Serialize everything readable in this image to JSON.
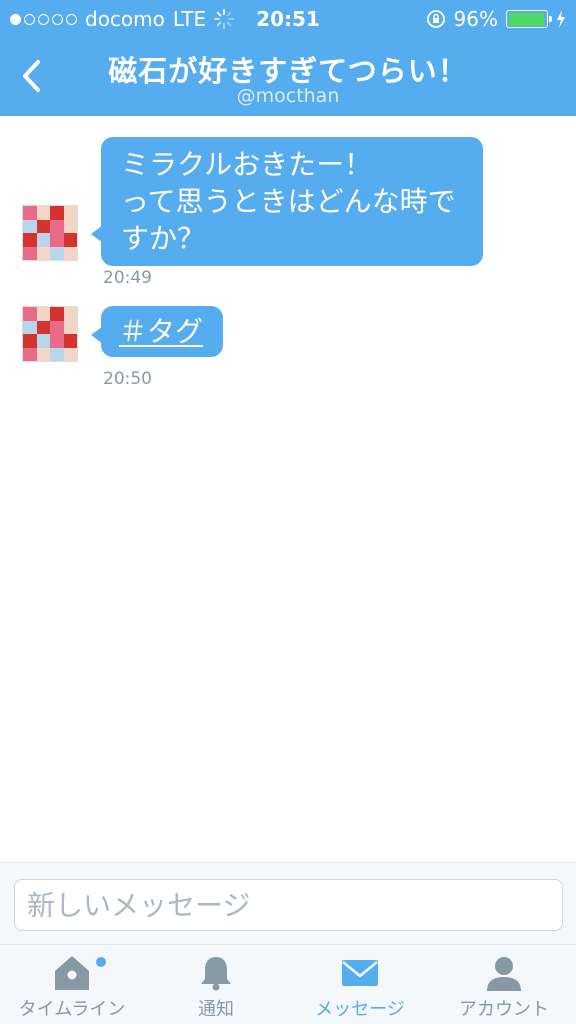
{
  "status": {
    "carrier": "docomo",
    "network": "LTE",
    "time": "20:51",
    "battery": "96%",
    "battery_level": 0.96
  },
  "header": {
    "title": "磁石が好きすぎてつらい！",
    "username": "@mocthan"
  },
  "messages": [
    {
      "lines": [
        "ミラクルおきたー！",
        "って思うときはどんな時で",
        "すか？"
      ],
      "time": "20:49"
    },
    {
      "text": "＃タグ",
      "time": "20:50"
    }
  ],
  "composer": {
    "placeholder": "新しいメッセージ"
  },
  "tabs": [
    {
      "label": "タイムライン",
      "icon": "home-icon"
    },
    {
      "label": "通知",
      "icon": "bell-icon"
    },
    {
      "label": "メッセージ",
      "icon": "envelope-icon"
    },
    {
      "label": "アカウント",
      "icon": "person-icon"
    }
  ],
  "colors": {
    "accent": "#55acee",
    "inactive": "#8899a6",
    "battery": "#4cd964"
  }
}
